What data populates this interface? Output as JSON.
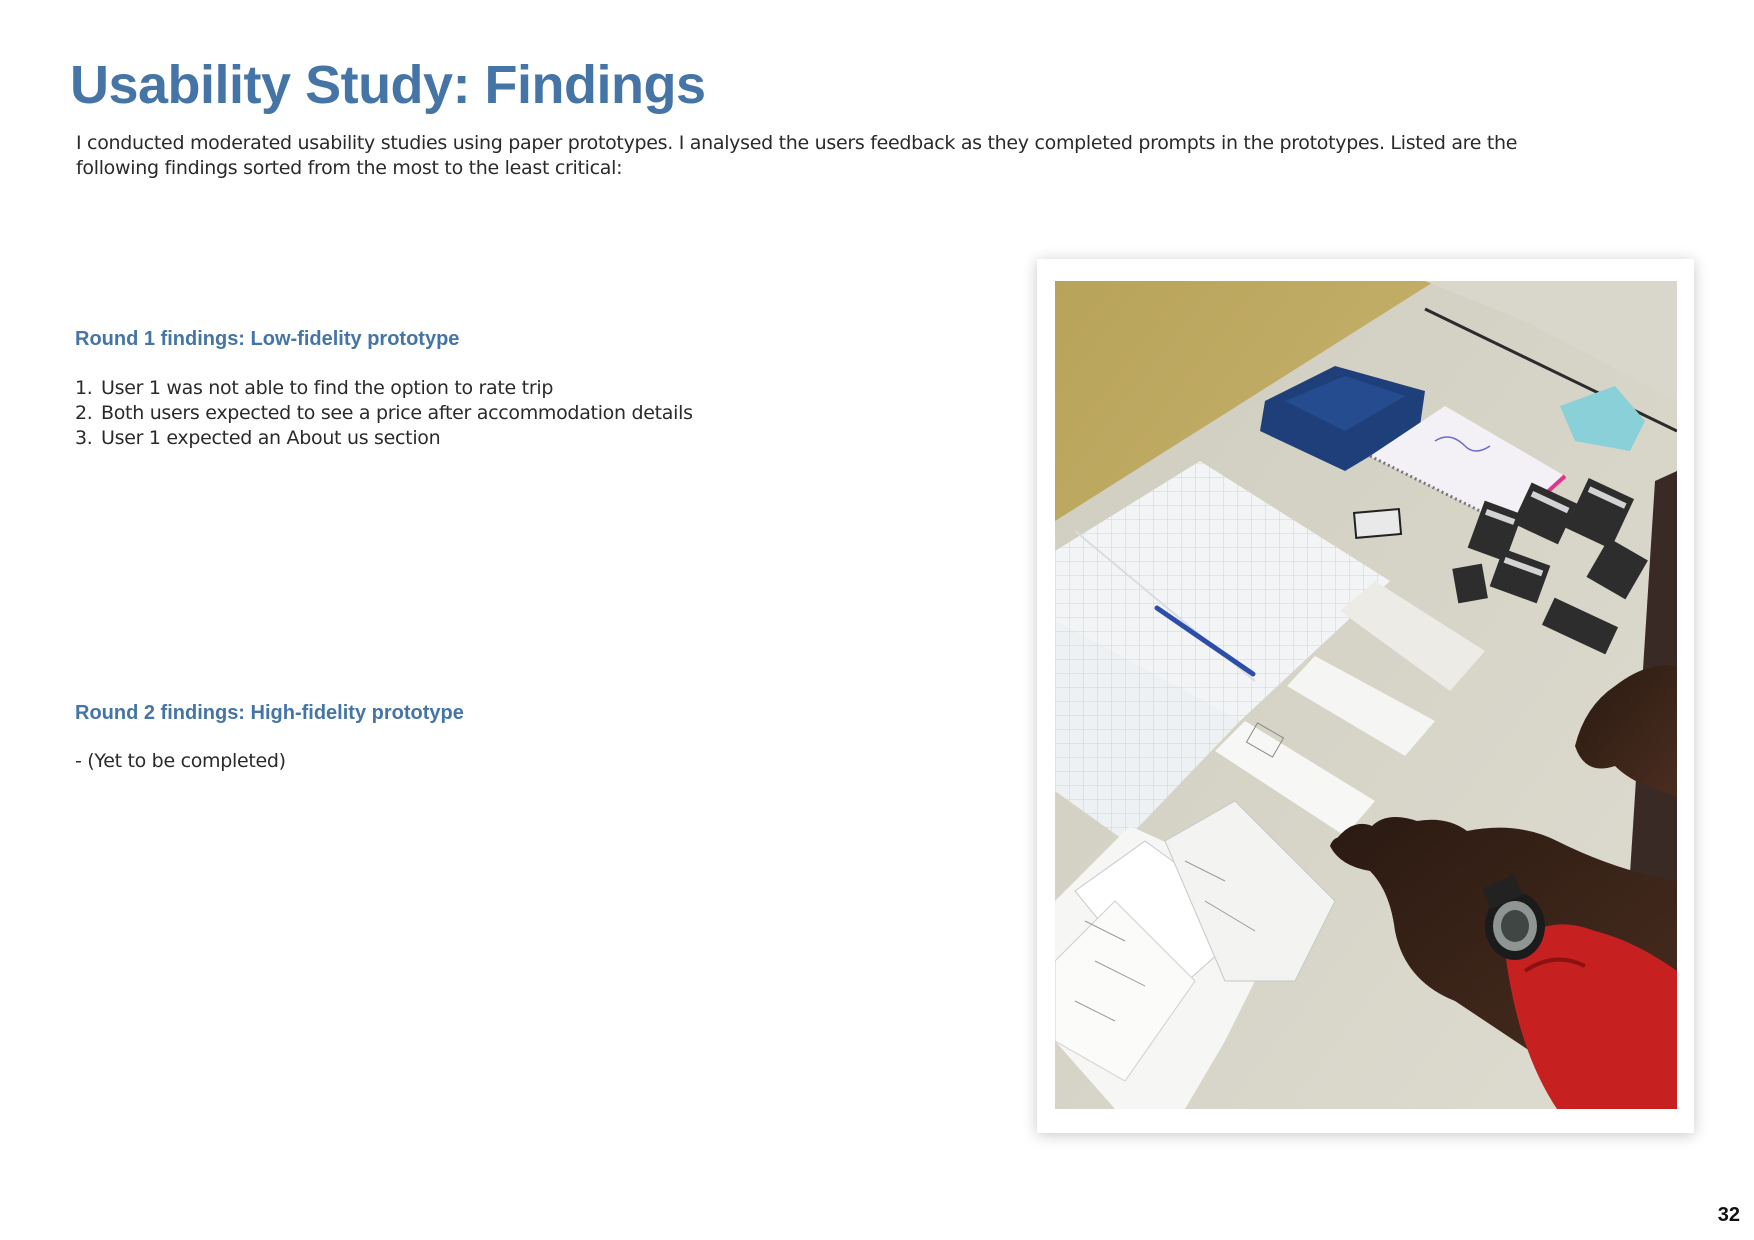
{
  "page": {
    "title": "Usability Study: Findings",
    "intro": "I conducted moderated usability studies using paper prototypes. I analysed the users feedback as they completed prompts in the prototypes. Listed are the following findings sorted from the most to the least critical:",
    "page_number": "32"
  },
  "round1": {
    "heading": "Round 1 findings: Low-fidelity prototype",
    "items": [
      {
        "num": "1.",
        "text": "User 1 was not able to find the option to rate trip"
      },
      {
        "num": "2.",
        "text": "Both users expected to see a price after accommodation details"
      },
      {
        "num": "3.",
        "text": "User 1 expected an About us section"
      }
    ]
  },
  "round2": {
    "heading": "Round 2 findings: High-fidelity prototype",
    "text": "- (Yet to be completed)"
  },
  "colors": {
    "accent": "#4575a6",
    "body_text": "#2a2a2a"
  }
}
